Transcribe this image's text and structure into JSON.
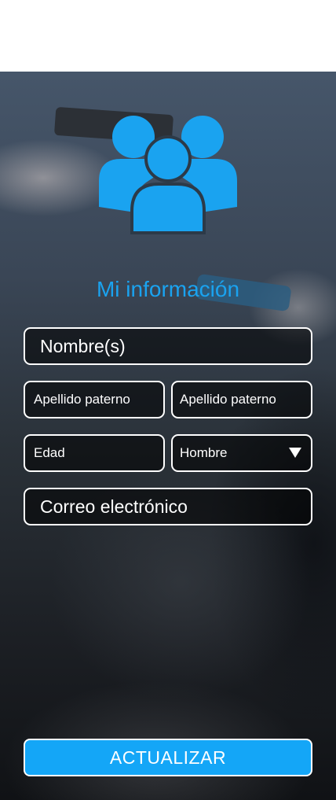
{
  "header": {
    "title": "Mi información"
  },
  "form": {
    "nombre": {
      "placeholder": "Nombre(s)"
    },
    "apellido_paterno": {
      "placeholder": "Apellido paterno"
    },
    "apellido_materno": {
      "placeholder": "Apellido paterno"
    },
    "edad": {
      "placeholder": "Edad"
    },
    "sexo": {
      "selected": "Hombre"
    },
    "correo": {
      "placeholder": "Correo electrónico"
    }
  },
  "actions": {
    "update_label": "ACTUALIZAR"
  },
  "colors": {
    "accent": "#1aa3f0",
    "button": "#14a6f7",
    "border": "#ffffff"
  },
  "icons": {
    "header_icon": "users-group-icon",
    "dropdown_icon": "caret-down-icon"
  }
}
